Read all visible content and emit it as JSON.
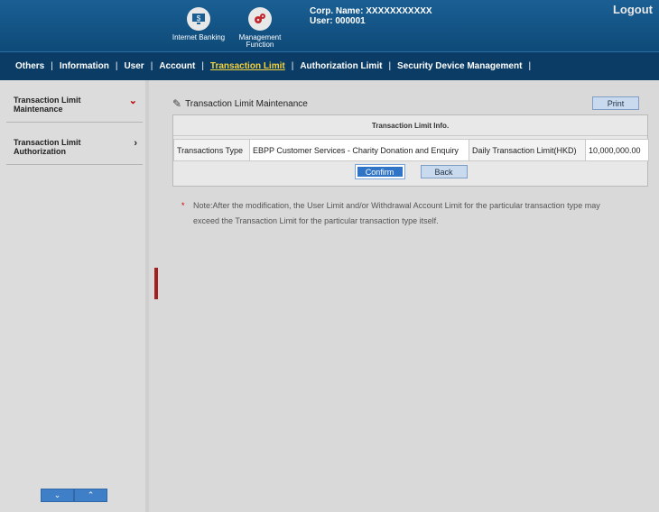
{
  "header": {
    "icons": [
      {
        "label": "Internet Banking",
        "icon": "monitor-dollar-icon"
      },
      {
        "label": "Management Function",
        "icon": "gears-icon"
      }
    ],
    "corp_name": "Corp. Name: XXXXXXXXXXX",
    "user": "User: 000001",
    "logout": "Logout"
  },
  "nav": {
    "items": [
      "Others",
      "Information",
      "User",
      "Account",
      "Transaction Limit",
      "Authorization Limit",
      "Security Device Management"
    ],
    "active": "Transaction Limit",
    "separator": "|"
  },
  "sidebar": {
    "items": [
      {
        "label": "Transaction Limit Maintenance",
        "arrow": "chevron-down-icon"
      },
      {
        "label": "Transaction Limit Authorization",
        "arrow": "chevron-right-icon"
      }
    ]
  },
  "main": {
    "title": "Transaction Limit Maintenance",
    "print_label": "Print",
    "box_heading": "Transaction Limit Info.",
    "row": {
      "type_label": "Transactions Type",
      "type_value": "EBPP Customer Services - Charity Donation and Enquiry",
      "limit_label": "Daily Transaction Limit(HKD)",
      "limit_value": "10,000,000.00"
    },
    "confirm_label": "Confirm",
    "back_label": "Back",
    "note_star": "*",
    "note_line1": "Note:After the modification, the User Limit and/or Withdrawal Account Limit for the particular transaction type may",
    "note_line2": "exceed the Transaction Limit for the particular transaction type itself."
  },
  "colors": {
    "header": "#1a5f94",
    "nav": "#0a3c66",
    "active_nav": "#f5d23c",
    "primary_button": "#2f74c6"
  }
}
